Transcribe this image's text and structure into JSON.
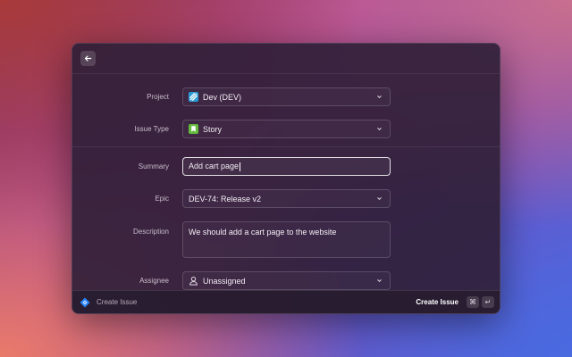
{
  "header": {
    "back_icon": "arrow-left-icon"
  },
  "form": {
    "project": {
      "label": "Project",
      "value": "Dev (DEV)",
      "icon": "project-icon"
    },
    "issue_type": {
      "label": "Issue Type",
      "value": "Story",
      "icon": "story-icon"
    },
    "summary": {
      "label": "Summary",
      "value": "Add cart page"
    },
    "epic": {
      "label": "Epic",
      "value": "DEV-74: Release v2"
    },
    "description": {
      "label": "Description",
      "value": "We should add a cart page to the website"
    },
    "assignee": {
      "label": "Assignee",
      "value": "Unassigned",
      "icon": "user-icon"
    }
  },
  "footer": {
    "title": "Create Issue",
    "action_label": "Create Issue",
    "shortcut_cmd": "⌘",
    "shortcut_enter": "↵",
    "app_icon": "jira-icon"
  },
  "colors": {
    "accent": "#2684ff",
    "story": "#63ba3c",
    "window_bg": "#302038"
  }
}
